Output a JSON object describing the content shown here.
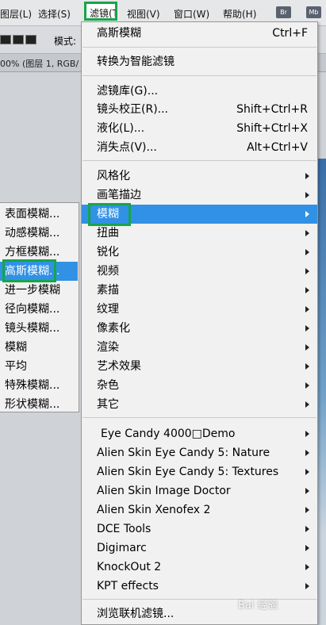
{
  "menubar": {
    "items": [
      "图层(L)",
      "选择(S)",
      "滤镜(T)",
      "视图(V)",
      "窗口(W)",
      "帮助(H)"
    ],
    "apps": [
      "Br",
      "Mb"
    ]
  },
  "options": {
    "mode_label": "模式:"
  },
  "document": {
    "title": "00% (图层 1, RGB/"
  },
  "filter_menu": {
    "items": [
      {
        "label": "高斯模糊",
        "shortcut": "Ctrl+F"
      },
      {
        "label": "转换为智能滤镜",
        "shortcut": ""
      },
      {
        "label": "滤镜库(G)...",
        "shortcut": ""
      },
      {
        "label": "镜头校正(R)...",
        "shortcut": "Shift+Ctrl+R"
      },
      {
        "label": "液化(L)...",
        "shortcut": "Shift+Ctrl+X"
      },
      {
        "label": "消失点(V)...",
        "shortcut": "Alt+Ctrl+V"
      },
      {
        "label": "风格化",
        "shortcut": ""
      },
      {
        "label": "画笔描边",
        "shortcut": ""
      },
      {
        "label": "模糊",
        "shortcut": ""
      },
      {
        "label": "扭曲",
        "shortcut": ""
      },
      {
        "label": "锐化",
        "shortcut": ""
      },
      {
        "label": "视频",
        "shortcut": ""
      },
      {
        "label": "素描",
        "shortcut": ""
      },
      {
        "label": "纹理",
        "shortcut": ""
      },
      {
        "label": "像素化",
        "shortcut": ""
      },
      {
        "label": "渲染",
        "shortcut": ""
      },
      {
        "label": "艺术效果",
        "shortcut": ""
      },
      {
        "label": "杂色",
        "shortcut": ""
      },
      {
        "label": "其它",
        "shortcut": ""
      },
      {
        "label": "Eye Candy 4000□Demo",
        "shortcut": ""
      },
      {
        "label": "Alien Skin Eye Candy 5: Nature",
        "shortcut": ""
      },
      {
        "label": "Alien Skin Eye Candy 5: Textures",
        "shortcut": ""
      },
      {
        "label": "Alien Skin Image Doctor",
        "shortcut": ""
      },
      {
        "label": "Alien Skin Xenofex 2",
        "shortcut": ""
      },
      {
        "label": "DCE Tools",
        "shortcut": ""
      },
      {
        "label": "Digimarc",
        "shortcut": ""
      },
      {
        "label": "KnockOut 2",
        "shortcut": ""
      },
      {
        "label": "KPT effects",
        "shortcut": ""
      },
      {
        "label": "浏览联机滤镜...",
        "shortcut": ""
      }
    ]
  },
  "blur_submenu": {
    "items": [
      "表面模糊...",
      "动感模糊...",
      "方框模糊...",
      "高斯模糊...",
      "进一步模糊",
      "径向模糊...",
      "镜头模糊...",
      "模糊",
      "平均",
      "特殊模糊...",
      "形状模糊..."
    ]
  },
  "watermark": "Bai 经验"
}
